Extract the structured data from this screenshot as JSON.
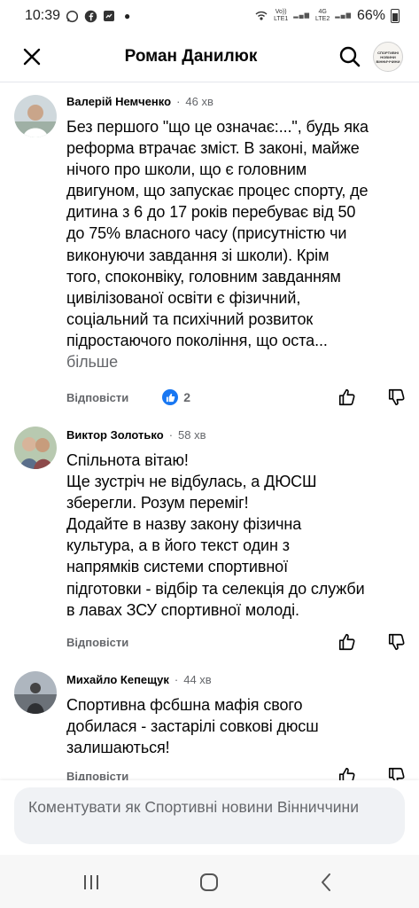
{
  "status_bar": {
    "time": "10:39",
    "network_label_top": "Vo))",
    "network_label_bottom": "LTE1",
    "network_type": "4G",
    "network_type_sub": "LTE2",
    "battery": "66%",
    "notification_icons": [
      "whatsapp-icon",
      "facebook-icon",
      "messenger-icon"
    ]
  },
  "header": {
    "title": "Роман Данилюк",
    "page_avatar_text": "СПОРТИВНІ НОВИНИ ВІННИЧЧИНИ"
  },
  "comments": [
    {
      "author": "Валерій Немченко",
      "time": "46 хв",
      "text": "Без першого \"що це означає:...\", будь яка\nреформа втрачає зміст. В законі, майже\nнічого про школи, що є головним\nдвигуном, що запускає процес спорту, де\nдитина з 6 до 17 років перебуває від 50\nдо 75% власного часу (присутністю чи\nвиконуючи завдання зі школи). Крім\nтого, споконвіку, головним завданням\nцивілізованої освіти є фізичний,\nсоціальний та психічний розвиток\nпідростаючого покоління, що оста...",
      "more": "більше",
      "reply": "Відповісти",
      "reaction_count": "2"
    },
    {
      "author": "Виктор Золотько",
      "time": "58 хв",
      "text": "Спільнота вітаю!\nЩе зустріч не відбулась, а ДЮСШ\nзберегли. Розум переміг!\nДодайте в назву закону фізична\nкультура, а в його текст один з\nнапрямків системи спортивної\nпідготовки - відбір та селекція до служби\nв лавах ЗСУ спортивної молоді.",
      "reply": "Відповісти"
    },
    {
      "author": "Михайло Кепещук",
      "time": "44 хв",
      "text": "Спортивна фсбшна мафія свого\nдобилася - застарілі совкові дюсш\nзалишаються!",
      "reply": "Відповісти"
    }
  ],
  "composer": {
    "placeholder": "Коментувати як Спортивні новини Вінниччини"
  },
  "colors": {
    "facebook_blue": "#1877f2",
    "secondary_text": "#65676b",
    "composer_bg": "#f0f2f5"
  }
}
